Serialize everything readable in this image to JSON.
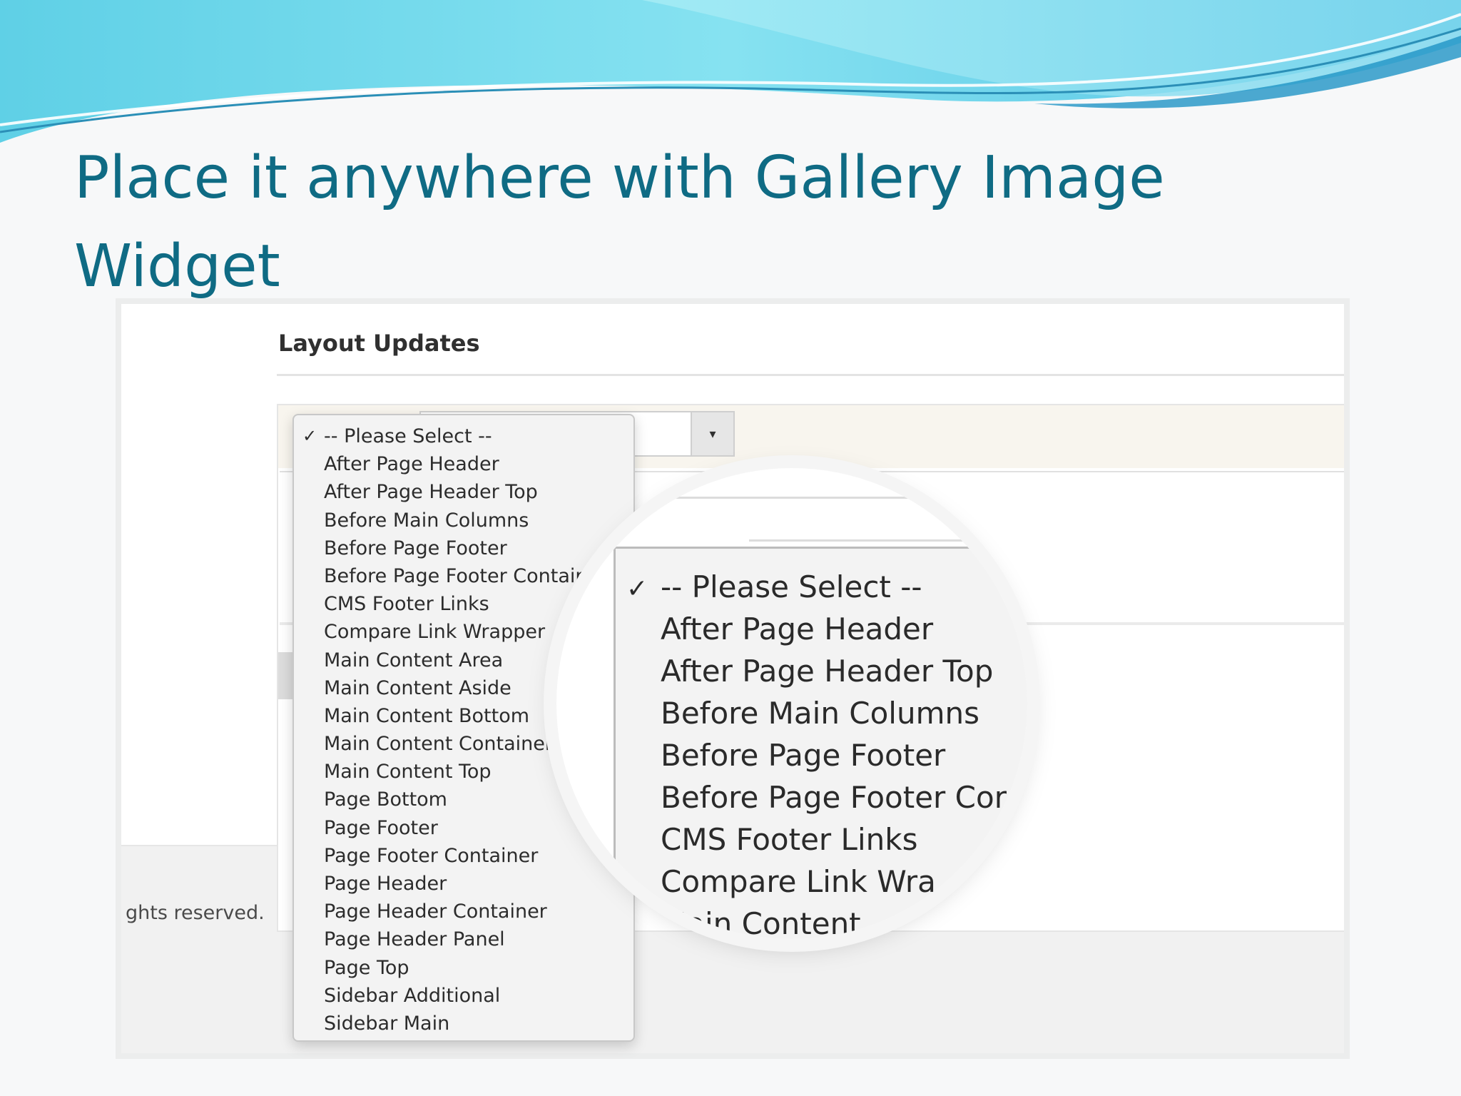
{
  "slide": {
    "title": "Place it anywhere with Gallery Image Widget"
  },
  "screenshot": {
    "section_title": "Layout Updates",
    "copyright_fragment": "ghts reserved.",
    "dropdown": {
      "selected": "-- Please Select --",
      "options": [
        "-- Please Select --",
        "After Page Header",
        "After Page Header Top",
        "Before Main Columns",
        "Before Page Footer",
        "Before Page Footer Containe",
        "CMS Footer Links",
        "Compare Link Wrapper",
        "Main Content Area",
        "Main Content Aside",
        "Main Content Bottom",
        "Main Content Container",
        "Main Content Top",
        "Page Bottom",
        "Page Footer",
        "Page Footer Container",
        "Page Header",
        "Page Header Container",
        "Page Header Panel",
        "Page Top",
        "Sidebar Additional",
        "Sidebar Main"
      ]
    },
    "magnifier": {
      "options": [
        "-- Please Select --",
        "After Page Header",
        "After Page Header Top",
        "Before Main Columns",
        "Before Page Footer",
        "Before Page Footer Cor",
        "CMS Footer Links",
        "Compare Link Wra",
        "Main Content"
      ]
    }
  },
  "icons": {
    "check": "check-icon",
    "dropdown_arrow": "triangle-down-icon"
  },
  "colors": {
    "title": "#0f6b84",
    "wave_light": "#8fe3f0",
    "wave_dark": "#2aa9cf",
    "select_row": "#f8f5ee"
  }
}
